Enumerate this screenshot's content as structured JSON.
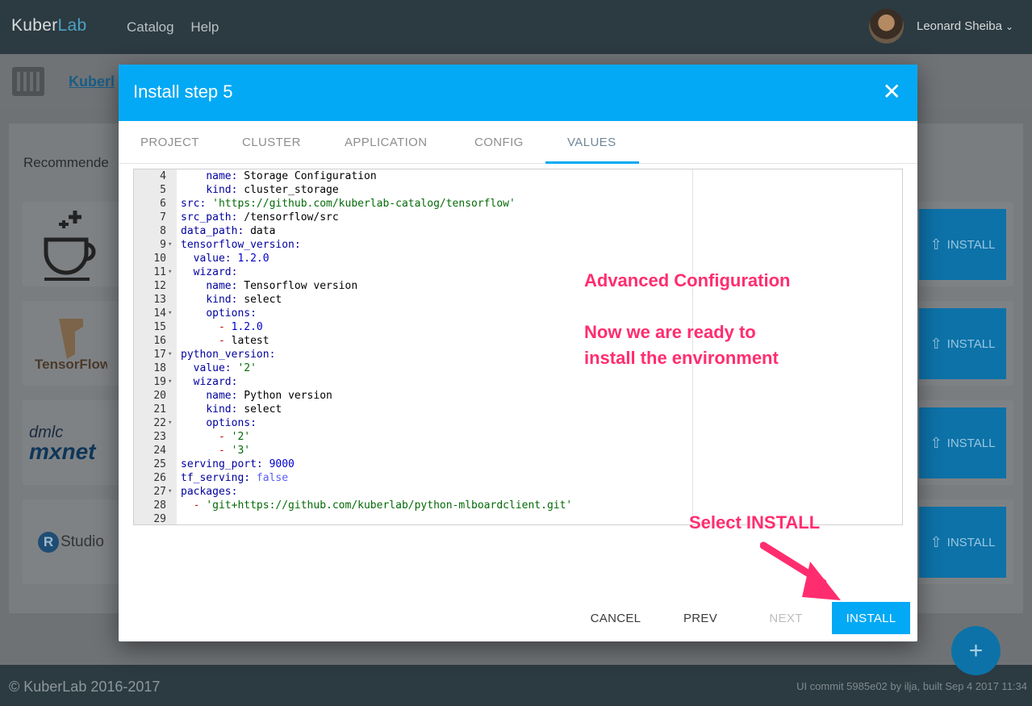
{
  "topbar": {
    "brand_a": "Kuber",
    "brand_b": "Lab",
    "nav": [
      "Catalog",
      "Help"
    ],
    "user_name": "Leonard Sheiba"
  },
  "page": {
    "breadcrumb": "Kuberl",
    "recommended_title": "Recommende",
    "cards": [
      {
        "logo": "coffee",
        "install_label": "INSTALL"
      },
      {
        "logo": "TensorFlow",
        "install_label": "INSTALL"
      },
      {
        "logo": "mxnet",
        "install_label": "INSTALL"
      },
      {
        "logo": "RStudio",
        "install_label": "INSTALL"
      }
    ]
  },
  "modal": {
    "title": "Install step 5",
    "tabs": [
      "PROJECT",
      "CLUSTER",
      "APPLICATION",
      "CONFIG",
      "VALUES"
    ],
    "active_tab": "VALUES",
    "buttons": {
      "cancel": "CANCEL",
      "prev": "PREV",
      "next": "NEXT",
      "install": "INSTALL"
    }
  },
  "editor_lines": [
    {
      "n": "4",
      "fold": false,
      "text": "    name: Storage Configuration"
    },
    {
      "n": "5",
      "fold": false,
      "text": "    kind: cluster_storage"
    },
    {
      "n": "6",
      "fold": false,
      "text": "src: 'https://github.com/kuberlab-catalog/tensorflow'"
    },
    {
      "n": "7",
      "fold": false,
      "text": "src_path: /tensorflow/src"
    },
    {
      "n": "8",
      "fold": false,
      "text": "data_path: data"
    },
    {
      "n": "9",
      "fold": true,
      "text": "tensorflow_version:"
    },
    {
      "n": "10",
      "fold": false,
      "text": "  value: 1.2.0"
    },
    {
      "n": "11",
      "fold": true,
      "text": "  wizard:"
    },
    {
      "n": "12",
      "fold": false,
      "text": "    name: Tensorflow version"
    },
    {
      "n": "13",
      "fold": false,
      "text": "    kind: select"
    },
    {
      "n": "14",
      "fold": true,
      "text": "    options:"
    },
    {
      "n": "15",
      "fold": false,
      "text": "      - 1.2.0"
    },
    {
      "n": "16",
      "fold": false,
      "text": "      - latest"
    },
    {
      "n": "17",
      "fold": true,
      "text": "python_version:"
    },
    {
      "n": "18",
      "fold": false,
      "text": "  value: '2'"
    },
    {
      "n": "19",
      "fold": true,
      "text": "  wizard:"
    },
    {
      "n": "20",
      "fold": false,
      "text": "    name: Python version"
    },
    {
      "n": "21",
      "fold": false,
      "text": "    kind: select"
    },
    {
      "n": "22",
      "fold": true,
      "text": "    options:"
    },
    {
      "n": "23",
      "fold": false,
      "text": "      - '2'"
    },
    {
      "n": "24",
      "fold": false,
      "text": "      - '3'"
    },
    {
      "n": "25",
      "fold": false,
      "text": "serving_port: 9000"
    },
    {
      "n": "26",
      "fold": false,
      "text": "tf_serving: false"
    },
    {
      "n": "27",
      "fold": true,
      "text": "packages:"
    },
    {
      "n": "28",
      "fold": false,
      "text": "  - 'git+https://github.com/kuberlab/python-mlboardclient.git'"
    },
    {
      "n": "29",
      "fold": false,
      "text": ""
    }
  ],
  "annotations": {
    "title": "Advanced Configuration",
    "line1": "Now we are ready to",
    "line2": "install the environment",
    "select": "Select INSTALL"
  },
  "footer": {
    "copyright": "© KuberLab 2016-2017",
    "commit": "UI commit 5985e02 by ilja, built Sep 4 2017 11:34"
  },
  "colors": {
    "accent": "#03a9f4",
    "annotation": "#ff2d6f",
    "topbar": "#2c3a41"
  }
}
